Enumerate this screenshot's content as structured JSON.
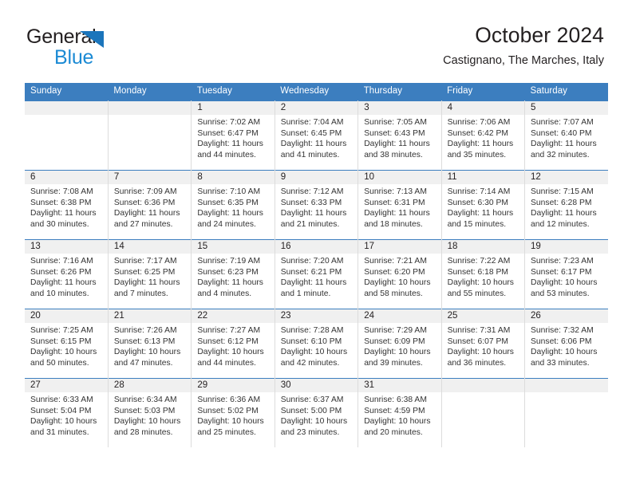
{
  "logo": {
    "text_top": "General",
    "text_bottom": "Blue",
    "triangle_color": "#1b75bb",
    "bottom_color": "#1b8ad4"
  },
  "header": {
    "title": "October 2024",
    "subtitle": "Castignano, The Marches, Italy"
  },
  "colors": {
    "header_bar": "#3c7ebf",
    "daynum_band": "#f0f0f0",
    "cell_border": "#dcdcdc",
    "text": "#231f20"
  },
  "weekday_headers": [
    "Sunday",
    "Monday",
    "Tuesday",
    "Wednesday",
    "Thursday",
    "Friday",
    "Saturday"
  ],
  "weeks": [
    [
      {
        "day": "",
        "lines": [
          "",
          "",
          "",
          ""
        ]
      },
      {
        "day": "",
        "lines": [
          "",
          "",
          "",
          ""
        ]
      },
      {
        "day": "1",
        "lines": [
          "Sunrise: 7:02 AM",
          "Sunset: 6:47 PM",
          "Daylight: 11 hours",
          "and 44 minutes."
        ]
      },
      {
        "day": "2",
        "lines": [
          "Sunrise: 7:04 AM",
          "Sunset: 6:45 PM",
          "Daylight: 11 hours",
          "and 41 minutes."
        ]
      },
      {
        "day": "3",
        "lines": [
          "Sunrise: 7:05 AM",
          "Sunset: 6:43 PM",
          "Daylight: 11 hours",
          "and 38 minutes."
        ]
      },
      {
        "day": "4",
        "lines": [
          "Sunrise: 7:06 AM",
          "Sunset: 6:42 PM",
          "Daylight: 11 hours",
          "and 35 minutes."
        ]
      },
      {
        "day": "5",
        "lines": [
          "Sunrise: 7:07 AM",
          "Sunset: 6:40 PM",
          "Daylight: 11 hours",
          "and 32 minutes."
        ]
      }
    ],
    [
      {
        "day": "6",
        "lines": [
          "Sunrise: 7:08 AM",
          "Sunset: 6:38 PM",
          "Daylight: 11 hours",
          "and 30 minutes."
        ]
      },
      {
        "day": "7",
        "lines": [
          "Sunrise: 7:09 AM",
          "Sunset: 6:36 PM",
          "Daylight: 11 hours",
          "and 27 minutes."
        ]
      },
      {
        "day": "8",
        "lines": [
          "Sunrise: 7:10 AM",
          "Sunset: 6:35 PM",
          "Daylight: 11 hours",
          "and 24 minutes."
        ]
      },
      {
        "day": "9",
        "lines": [
          "Sunrise: 7:12 AM",
          "Sunset: 6:33 PM",
          "Daylight: 11 hours",
          "and 21 minutes."
        ]
      },
      {
        "day": "10",
        "lines": [
          "Sunrise: 7:13 AM",
          "Sunset: 6:31 PM",
          "Daylight: 11 hours",
          "and 18 minutes."
        ]
      },
      {
        "day": "11",
        "lines": [
          "Sunrise: 7:14 AM",
          "Sunset: 6:30 PM",
          "Daylight: 11 hours",
          "and 15 minutes."
        ]
      },
      {
        "day": "12",
        "lines": [
          "Sunrise: 7:15 AM",
          "Sunset: 6:28 PM",
          "Daylight: 11 hours",
          "and 12 minutes."
        ]
      }
    ],
    [
      {
        "day": "13",
        "lines": [
          "Sunrise: 7:16 AM",
          "Sunset: 6:26 PM",
          "Daylight: 11 hours",
          "and 10 minutes."
        ]
      },
      {
        "day": "14",
        "lines": [
          "Sunrise: 7:17 AM",
          "Sunset: 6:25 PM",
          "Daylight: 11 hours",
          "and 7 minutes."
        ]
      },
      {
        "day": "15",
        "lines": [
          "Sunrise: 7:19 AM",
          "Sunset: 6:23 PM",
          "Daylight: 11 hours",
          "and 4 minutes."
        ]
      },
      {
        "day": "16",
        "lines": [
          "Sunrise: 7:20 AM",
          "Sunset: 6:21 PM",
          "Daylight: 11 hours",
          "and 1 minute."
        ]
      },
      {
        "day": "17",
        "lines": [
          "Sunrise: 7:21 AM",
          "Sunset: 6:20 PM",
          "Daylight: 10 hours",
          "and 58 minutes."
        ]
      },
      {
        "day": "18",
        "lines": [
          "Sunrise: 7:22 AM",
          "Sunset: 6:18 PM",
          "Daylight: 10 hours",
          "and 55 minutes."
        ]
      },
      {
        "day": "19",
        "lines": [
          "Sunrise: 7:23 AM",
          "Sunset: 6:17 PM",
          "Daylight: 10 hours",
          "and 53 minutes."
        ]
      }
    ],
    [
      {
        "day": "20",
        "lines": [
          "Sunrise: 7:25 AM",
          "Sunset: 6:15 PM",
          "Daylight: 10 hours",
          "and 50 minutes."
        ]
      },
      {
        "day": "21",
        "lines": [
          "Sunrise: 7:26 AM",
          "Sunset: 6:13 PM",
          "Daylight: 10 hours",
          "and 47 minutes."
        ]
      },
      {
        "day": "22",
        "lines": [
          "Sunrise: 7:27 AM",
          "Sunset: 6:12 PM",
          "Daylight: 10 hours",
          "and 44 minutes."
        ]
      },
      {
        "day": "23",
        "lines": [
          "Sunrise: 7:28 AM",
          "Sunset: 6:10 PM",
          "Daylight: 10 hours",
          "and 42 minutes."
        ]
      },
      {
        "day": "24",
        "lines": [
          "Sunrise: 7:29 AM",
          "Sunset: 6:09 PM",
          "Daylight: 10 hours",
          "and 39 minutes."
        ]
      },
      {
        "day": "25",
        "lines": [
          "Sunrise: 7:31 AM",
          "Sunset: 6:07 PM",
          "Daylight: 10 hours",
          "and 36 minutes."
        ]
      },
      {
        "day": "26",
        "lines": [
          "Sunrise: 7:32 AM",
          "Sunset: 6:06 PM",
          "Daylight: 10 hours",
          "and 33 minutes."
        ]
      }
    ],
    [
      {
        "day": "27",
        "lines": [
          "Sunrise: 6:33 AM",
          "Sunset: 5:04 PM",
          "Daylight: 10 hours",
          "and 31 minutes."
        ]
      },
      {
        "day": "28",
        "lines": [
          "Sunrise: 6:34 AM",
          "Sunset: 5:03 PM",
          "Daylight: 10 hours",
          "and 28 minutes."
        ]
      },
      {
        "day": "29",
        "lines": [
          "Sunrise: 6:36 AM",
          "Sunset: 5:02 PM",
          "Daylight: 10 hours",
          "and 25 minutes."
        ]
      },
      {
        "day": "30",
        "lines": [
          "Sunrise: 6:37 AM",
          "Sunset: 5:00 PM",
          "Daylight: 10 hours",
          "and 23 minutes."
        ]
      },
      {
        "day": "31",
        "lines": [
          "Sunrise: 6:38 AM",
          "Sunset: 4:59 PM",
          "Daylight: 10 hours",
          "and 20 minutes."
        ]
      },
      {
        "day": "",
        "lines": [
          "",
          "",
          "",
          ""
        ]
      },
      {
        "day": "",
        "lines": [
          "",
          "",
          "",
          ""
        ]
      }
    ]
  ]
}
